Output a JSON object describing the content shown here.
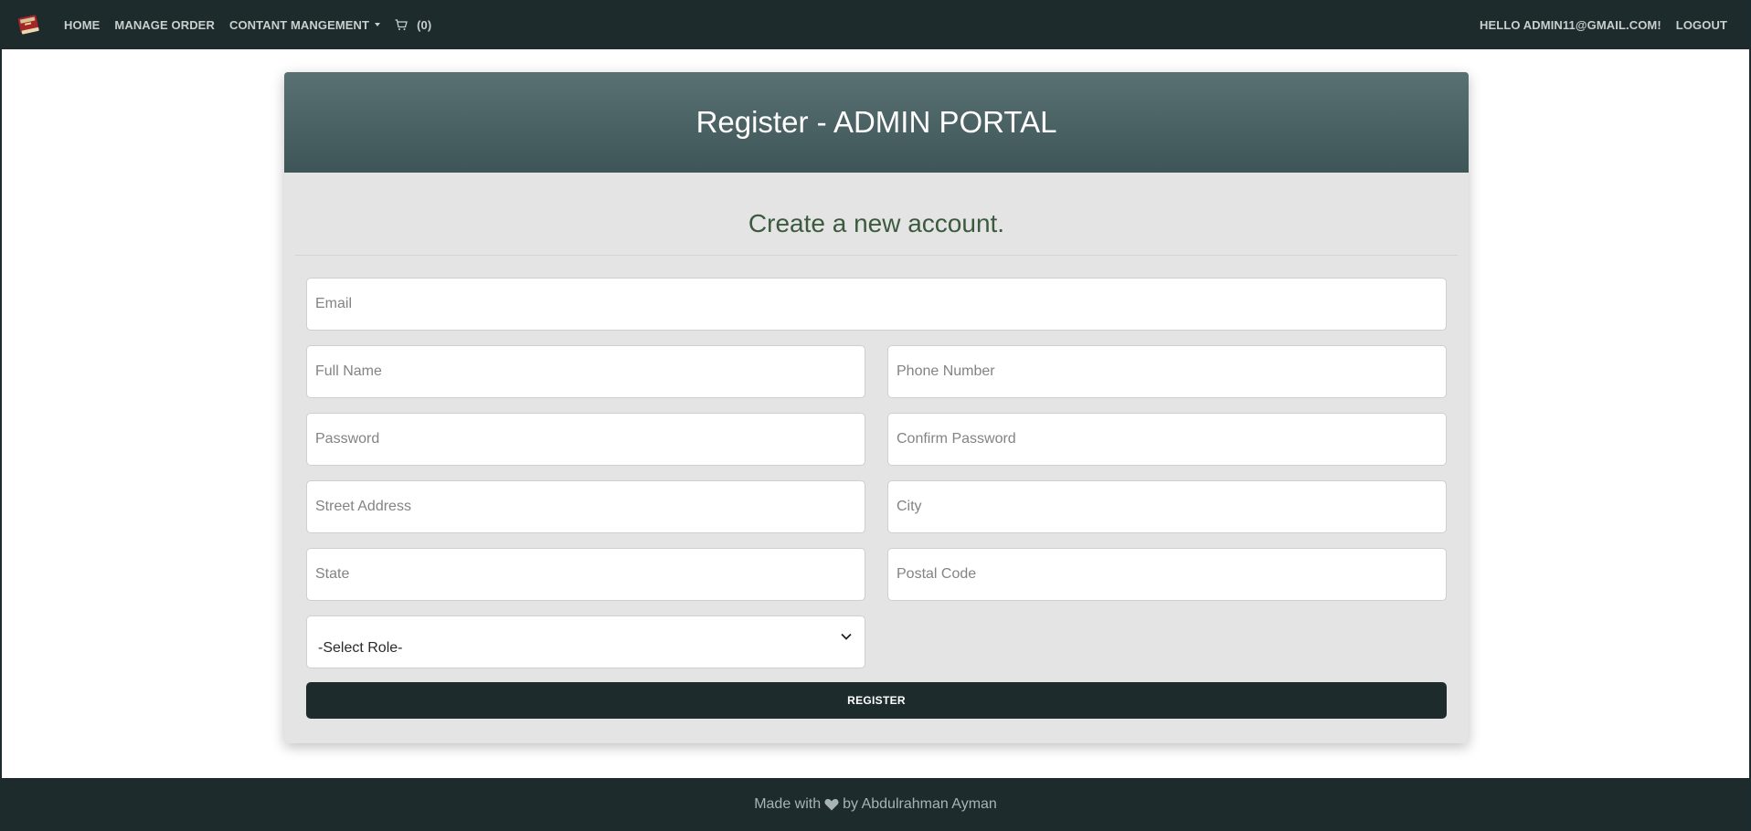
{
  "navbar": {
    "logo_icon": "book-icon",
    "items": [
      {
        "label": "HOME"
      },
      {
        "label": "MANAGE ORDER"
      },
      {
        "label": "CONTANT MANGEMENT"
      }
    ],
    "cart_count": "(0)",
    "greeting": "HELLO ADMIN11@GMAIL.COM!",
    "logout": "LOGOUT"
  },
  "card": {
    "header_title": "Register - ADMIN PORTAL",
    "subtitle": "Create a new account."
  },
  "form": {
    "email_placeholder": "Email",
    "full_name_placeholder": "Full Name",
    "phone_placeholder": "Phone Number",
    "password_placeholder": "Password",
    "confirm_password_placeholder": "Confirm Password",
    "street_placeholder": "Street Address",
    "city_placeholder": "City",
    "state_placeholder": "State",
    "postal_placeholder": "Postal Code",
    "role_selected": "-Select Role-",
    "register_label": "REGISTER"
  },
  "footer": {
    "made_with": "Made with",
    "by": "by Abdulrahman Ayman"
  },
  "colors": {
    "navbar_bg": "#1d2b2d",
    "header_gradient_top": "#5a7173",
    "header_gradient_bottom": "#3e5558",
    "subtitle_color": "#3b5a3e",
    "card_bg": "#e4e4e4"
  }
}
